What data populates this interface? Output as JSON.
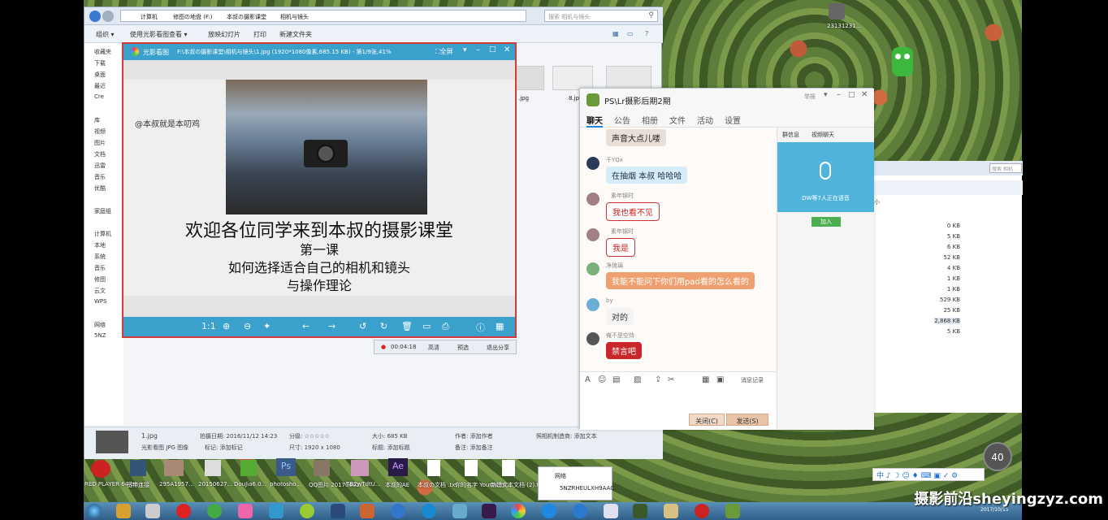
{
  "explorer": {
    "breadcrumb": [
      "计算机",
      "修图の地盘 (F:)",
      "本叔の摄影课堂",
      "相机与镜头"
    ],
    "search_placeholder": "搜索 相机与镜头",
    "toolbar": [
      "组织 ▾",
      "使用光影看图查看 ▾",
      "放映幻灯片",
      "打印",
      "新建文件夹"
    ],
    "nav": [
      "收藏夹",
      "下载",
      "桌面",
      "最近",
      "Cre",
      "库",
      "视频",
      "图片",
      "文档",
      "迅雷",
      "音乐",
      "优酷",
      "家庭组",
      "计算机",
      "本地",
      "系统",
      "音乐",
      "修图",
      "云文",
      "WPS",
      "网络",
      "5NZ"
    ],
    "thumb_labels": [
      ".jpg",
      "8.jpg"
    ],
    "status": {
      "filename": "1.jpg",
      "filetype": "光影看图 JPG 图像",
      "date": "拍摄日期: 2016/11/12 14:23",
      "tags": "标记: 添加标记",
      "rating": "分级: ☆☆☆☆☆",
      "dims": "尺寸: 1920 x 1080",
      "size": "大小: 685 KB",
      "title": "标题: 添加标题",
      "author": "作者: 添加作者",
      "note": "备注: 添加备注",
      "camera": "照相机制造商: 添加文本"
    }
  },
  "viewer": {
    "app_name": "光影看图",
    "title": "F:\\本叔の摄影课堂\\相机与镜头\\1.jpg (1920*1080像素,685.15 KB) - 第1/9张,41%",
    "fullscreen_label": "全屏",
    "watermark_user": "@本叔就是本叨鸡",
    "headline": "欢迎各位同学来到本叔的摄影课堂",
    "line1": "第一课",
    "line2": "如何选择适合自己的相机和镜头",
    "line3": "与操作理论",
    "zoom_label": "1:1"
  },
  "recorder": {
    "time": "00:04:18",
    "buttons": [
      "高清",
      "预选",
      "退出分享"
    ]
  },
  "chat": {
    "group_title": "PS\\Lr摄影后期2期",
    "title_menu": "举报",
    "tabs": [
      "聊天",
      "公告",
      "相册",
      "文件",
      "活动",
      "设置"
    ],
    "messages": [
      {
        "nick": "",
        "text": "声音大点儿喽"
      },
      {
        "nick": "千YQx",
        "text": "在抽烟 本叔 哈哈哈"
      },
      {
        "nick": "素年锦时",
        "text": "我也看不见"
      },
      {
        "nick": "素年锦时",
        "text": "我是"
      },
      {
        "nick": "净琉璃",
        "text": "我能不能问下你们用pad看的怎么看的"
      },
      {
        "nick": "by",
        "text": "对的"
      },
      {
        "nick": "俺不是空侍",
        "text": "禁言吧"
      }
    ],
    "side_tabs": [
      "群信息",
      "视频聊天"
    ],
    "voice_status": "DW等7人正在语音",
    "join_label": "加入",
    "history_label": "消息记录",
    "close_label": "关闭(C)",
    "send_label": "发送(S)"
  },
  "ex2": {
    "search_placeholder": "搜索 相机",
    "col_header": "小",
    "sizes": [
      "0 KB",
      "5 KB",
      "6 KB",
      "52 KB",
      "4 KB",
      "1 KB",
      "1 KB",
      "529 KB",
      "25 KB",
      "2,868 KB",
      "5 KB"
    ]
  },
  "desktop_icons": [
    "RED PLAYER 64-bit",
    "宽带连接",
    "295A1957...",
    "20150627...",
    "DouJia6.0...",
    "photosho...",
    "QQ图片 20170602...",
    "TB2wTdtU...",
    "本叔的AE",
    "本叔の文档 .txt",
    "你的名字 Your.Nam...",
    "新建文本文档 (2).txt"
  ],
  "desktop_top_icon": "23131231...",
  "network": {
    "label": "网络",
    "pc": "5NZRHEULXH9AAC"
  },
  "zoom_badge": "40",
  "clock_date": "2017/10/15",
  "watermark_brand": "摄影前沿sheyingzyz.com",
  "colors": {
    "viewer_border": "#d43a3a",
    "viewer_bar": "#3aa0cc",
    "voice_panel": "#4fb3dc",
    "join_green": "#4caf50",
    "bubble_blue": "#d6ecfa",
    "bubble_orange": "#f0a070",
    "bubble_red": "#c8282a"
  }
}
